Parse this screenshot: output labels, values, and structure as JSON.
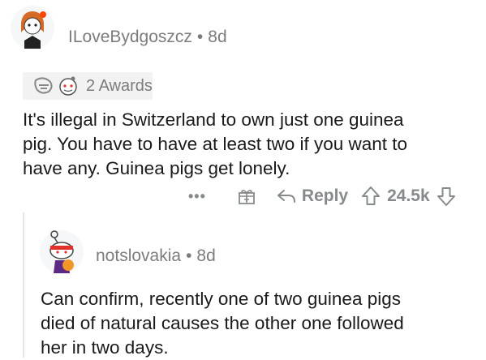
{
  "comment": {
    "username": "ILoveBydgoszcz",
    "separator": "•",
    "age": "8d",
    "awards_label": "2 Awards",
    "body": "It's illegal in Switzerland to own just one guinea\npig. You have to have at least two if you want to\nhave any. Guinea pigs get lonely.",
    "actions": {
      "more": "•••",
      "reply_label": "Reply",
      "score": "24.5k"
    }
  },
  "reply": {
    "username": "notslovakia",
    "separator": "•",
    "age": "8d",
    "body": "Can confirm, recently one of two guinea pigs\ndied of natural causes the other one followed\nher in two days."
  },
  "icons": [
    "avatar",
    "award-icon",
    "award-icon",
    "more-icon",
    "gift-icon",
    "reply-icon",
    "upvote-icon",
    "downvote-icon"
  ],
  "colors": {
    "meta_gray": "#7c7c7c",
    "action_gray": "#878a8c",
    "avatar_orange": "#ff4500"
  }
}
